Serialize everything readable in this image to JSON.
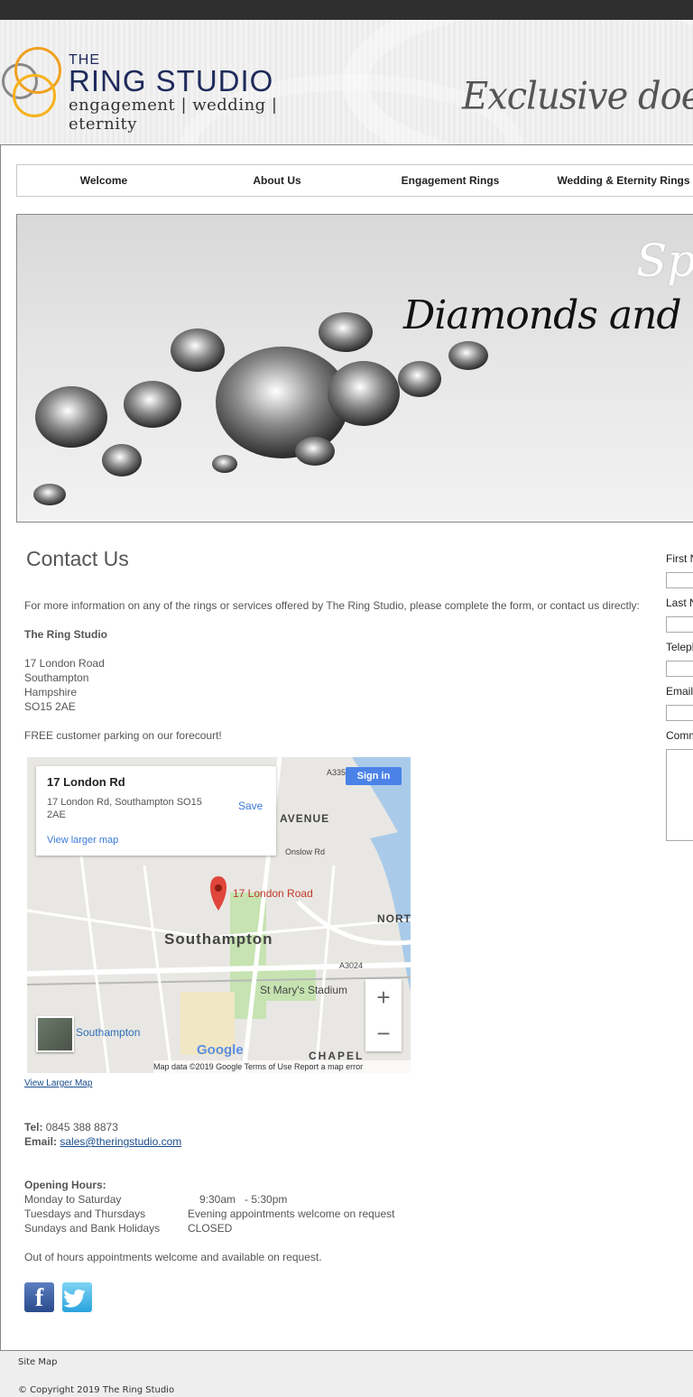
{
  "brand": {
    "logo_the": "THE",
    "logo_name": "RING STUDIO",
    "logo_sub": "engagement | wedding | eternity",
    "tagline": "Exclusive doesn 't have"
  },
  "nav": {
    "items": [
      "Welcome",
      "About Us",
      "Engagement Rings",
      "Wedding & Eternity Rings"
    ]
  },
  "banner": {
    "line1": "Spec",
    "line2": "Diamonds and Colour"
  },
  "contact": {
    "title": "Contact Us",
    "intro": "For more information on any of the rings or services offered by The Ring Studio, please complete the form, or contact us directly:",
    "company": "The Ring Studio",
    "address": [
      "17 London Road",
      "Southampton",
      "Hampshire",
      "SO15 2AE"
    ],
    "parking": "FREE customer parking on our forecourt!",
    "view_larger_map": "View Larger Map",
    "tel_label": "Tel:",
    "tel_value": "0845 388 8873",
    "email_label": "Email:",
    "email_value": "sales@theringstudio.com",
    "hours_title": "Opening Hours:",
    "hours": [
      {
        "day": "Monday to Saturday",
        "time": "9:30am   - 5:30pm"
      },
      {
        "day": "Tuesdays and Thursdays",
        "time": "Evening appointments welcome on request"
      },
      {
        "day": "Sundays and Bank Holidays",
        "time": "CLOSED"
      }
    ],
    "out_of_hours": "Out of hours appointments welcome and available on request."
  },
  "map": {
    "card_title": "17 London Rd",
    "card_address": "17 London Rd, Southampton SO15 2AE",
    "save": "Save",
    "view_larger": "View larger map",
    "signin": "Sign in",
    "pin_label": "17 London Road",
    "city": "Southampton",
    "avenue": "AVENUE",
    "north": "NORT",
    "chapel": "CHAPEL",
    "stadium": "St Mary's Stadium",
    "station": "Southampton",
    "road_a": "A335",
    "road_b": "A3024",
    "onslow": "Onslow Rd",
    "google": "Google",
    "footer": "Map data ©2019 Google    Terms of Use    Report a map error"
  },
  "form": {
    "labels": [
      "First N",
      "Last N",
      "Teleph",
      "Email",
      "Comm"
    ]
  },
  "social": {
    "facebook": "f"
  },
  "footer": {
    "sitemap": "Site Map",
    "copyright": "© Copyright 2019 The Ring Studio"
  }
}
